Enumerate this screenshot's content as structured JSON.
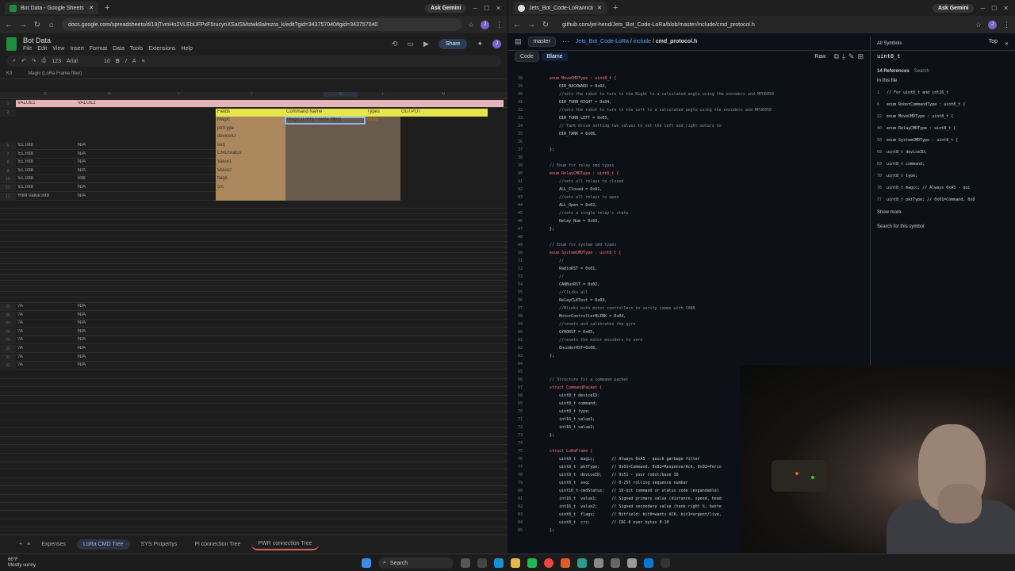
{
  "left_browser": {
    "tab_title": "Bot Data - Google Sheets",
    "url": "docs.google.com/spreadsheets/d/19jTvmHn2VLEbUFPxF5rucynXSaISMstwk8almzra_k/edit?gid=343757040#gid=343757040",
    "ask_gemini": "Ask Gemini"
  },
  "sheet": {
    "title": "Bot Data",
    "menu": [
      "File",
      "Edit",
      "View",
      "Insert",
      "Format",
      "Data",
      "Tools",
      "Extensions",
      "Help"
    ],
    "share_label": "Share",
    "font": "Arial",
    "font_size": "10",
    "zoom": "123",
    "cell_ref": "K3",
    "formula": "Magic (LoRa Frame filter)",
    "col_letters": [
      "G",
      "H",
      "I",
      "J",
      "K",
      "L",
      "M"
    ],
    "row3_headers": [
      "VALUE1",
      "VALUE2"
    ],
    "fields_header": "Fields",
    "command_name_header": "Command Name",
    "types_header": "Types",
    "output_header": "OUTPUT",
    "fields": [
      "Magic",
      "pktType",
      "deviceID",
      "seq",
      "CMDStatus",
      "Value1",
      "Value2",
      "flags",
      "crc"
    ],
    "magic_command": "Magic (LoRa Frame filter)",
    "magic_type": "0xA5",
    "upper_rows": [
      {
        "a": "'EL:int8",
        "b": "N/A"
      },
      {
        "a": "'EL:int8",
        "b": "N/A"
      },
      {
        "a": "'EL:int8",
        "b": "N/A"
      },
      {
        "a": "'EL:int8",
        "b": "N/A"
      },
      {
        "a": "'EL:int8",
        "b": "int8"
      },
      {
        "a": "'EL:int8",
        "b": "N/A"
      },
      {
        "a": "'RIM Value:int8",
        "b": "N/A"
      }
    ],
    "lower_rows": [
      {
        "a": "'/A",
        "b": "N/A"
      },
      {
        "a": "'/A",
        "b": "N/A"
      },
      {
        "a": "'/A",
        "b": "N/A"
      },
      {
        "a": "'/A",
        "b": "N/A"
      },
      {
        "a": "'/A",
        "b": "N/A"
      },
      {
        "a": "'/A",
        "b": "N/A"
      },
      {
        "a": "'/A",
        "b": "N/A"
      },
      {
        "a": "'/A",
        "b": "N/A"
      }
    ],
    "tabs": [
      "Expenses",
      "LoRa CMD Tree",
      "SYS Propertys",
      "Pi connection Tree",
      "PWR connection Tree"
    ]
  },
  "right_browser": {
    "tab_title": "Jets_Bot_Code-LoRa/include/c",
    "url": "github.com/jet-hend/Jets_Bot_Code-LoRa/blob/master/include/cmd_protocol.h",
    "ask_gemini": "Ask Gemini"
  },
  "github": {
    "branch": "master",
    "crumb_repo": "Jets_Bot_Code-LoRa",
    "crumb_dir": "include",
    "crumb_file": "cmd_protocol.h",
    "top_label": "Top",
    "code_tab": "Code",
    "blame_tab": "Blame",
    "raw_label": "Raw",
    "lines": [
      {
        "n": "28",
        "t": "    enum MoveCMDType : uint8_t {"
      },
      {
        "n": "29",
        "t": "        DIR_BACKWARD = 0x03,"
      },
      {
        "n": "30",
        "t": "        //sets the robot to turn to the Right to a calculated angle using the encoders and MPU6050"
      },
      {
        "n": "31",
        "t": "        DIR_TURN_RIGHT = 0x04,"
      },
      {
        "n": "32",
        "t": "        //sets the robot to turn to the Left to a calculated angle using the encoders and MPU6050"
      },
      {
        "n": "33",
        "t": "        DIR_TURN_LEFT = 0x05,"
      },
      {
        "n": "34",
        "t": "        // Tank drive setting two values to set the left and right motors to"
      },
      {
        "n": "35",
        "t": "        DIR_TANK = 0x06,"
      },
      {
        "n": "36",
        "t": ""
      },
      {
        "n": "37",
        "t": "    };"
      },
      {
        "n": "38",
        "t": ""
      },
      {
        "n": "39",
        "t": "    // Enum for relay cmd types"
      },
      {
        "n": "40",
        "t": "    enum RelayCMDType : uint8_t {"
      },
      {
        "n": "41",
        "t": "        //sets all relays to closed"
      },
      {
        "n": "42",
        "t": "        ALL_Closed = 0x01,"
      },
      {
        "n": "43",
        "t": "        //sets all relays to open"
      },
      {
        "n": "44",
        "t": "        ALL_Open = 0x02,"
      },
      {
        "n": "45",
        "t": "        //sets a single relay's state"
      },
      {
        "n": "46",
        "t": "        Relay_Num = 0x03,"
      },
      {
        "n": "47",
        "t": "    };"
      },
      {
        "n": "48",
        "t": ""
      },
      {
        "n": "49",
        "t": "    // Enum for system cmd types"
      },
      {
        "n": "50",
        "t": "    enum SystemCMDType : uint8_t {"
      },
      {
        "n": "51",
        "t": "        //"
      },
      {
        "n": "52",
        "t": "        RadioRST = 0x01,"
      },
      {
        "n": "53",
        "t": "        //"
      },
      {
        "n": "54",
        "t": "        CANBusRST = 0x02,"
      },
      {
        "n": "55",
        "t": "        //Clicks all"
      },
      {
        "n": "56",
        "t": "        RelayCLKTest = 0x03,"
      },
      {
        "n": "57",
        "t": "        //Blinks both motor controllers to verify comms with CAN0"
      },
      {
        "n": "58",
        "t": "        MotorControllerBLINK = 0x04,"
      },
      {
        "n": "59",
        "t": "        //resets and calibrates the gyro"
      },
      {
        "n": "60",
        "t": "        GYRORST = 0x05,"
      },
      {
        "n": "61",
        "t": "        //resets the motor encoders to zero"
      },
      {
        "n": "62",
        "t": "        EncoderRST=0x06,"
      },
      {
        "n": "63",
        "t": "    };"
      },
      {
        "n": "64",
        "t": ""
      },
      {
        "n": "65",
        "t": ""
      },
      {
        "n": "66",
        "t": "    // Structure for a command packet"
      },
      {
        "n": "67",
        "t": "    struct CommandPacket {"
      },
      {
        "n": "68",
        "t": "        uint8_t deviceID;"
      },
      {
        "n": "69",
        "t": "        uint8_t command;"
      },
      {
        "n": "70",
        "t": "        uint8_t type;"
      },
      {
        "n": "71",
        "t": "        int16_t value1;"
      },
      {
        "n": "72",
        "t": "        int16_t value2;"
      },
      {
        "n": "73",
        "t": "    };"
      },
      {
        "n": "74",
        "t": ""
      },
      {
        "n": "75",
        "t": "    struct LoRaFrame {"
      },
      {
        "n": "76",
        "t": "        uint8_t  magic;       // Always 0xA5 - quick garbage filter"
      },
      {
        "n": "77",
        "t": "        uint8_t  pktType;     // 0x01=Command, 0x81=Response/Ack, 0x02=Perio"
      },
      {
        "n": "78",
        "t": "        uint8_t  deviceID;    // 0x51 - your robot/base ID"
      },
      {
        "n": "79",
        "t": "        uint8_t  seq;         // 0-255 rolling sequence number"
      },
      {
        "n": "80",
        "t": "        uint16_t cmdStatus;   // 16-bit command or status code (expandable)"
      },
      {
        "n": "81",
        "t": "        int16_t  value1;      // Signed primary value (distance, speed, head"
      },
      {
        "n": "82",
        "t": "        int16_t  value2;      // Signed secondary value (tank right %, batte"
      },
      {
        "n": "83",
        "t": "        uint8_t  flags;       // Bitfield: bit0=wants ACK, bit1=urgent/live,"
      },
      {
        "n": "84",
        "t": "        uint8_t  crc;         // CRC-8 over bytes 0-10"
      },
      {
        "n": "85",
        "t": "    };"
      }
    ]
  },
  "symbols": {
    "header": "All Symbols",
    "symbol": "uint8_t",
    "refs": "14 References",
    "search": "Search",
    "in_file": "In this file",
    "items": [
      {
        "n": "1",
        "t": "// For uint8_t and int16_t"
      },
      {
        "n": "6",
        "t": "enum RobotCommandType : uint8_t {"
      },
      {
        "n": "22",
        "t": "enum MoveCMDType : uint8_t {"
      },
      {
        "n": "40",
        "t": "enum RelayCMDType : uint8_t {"
      },
      {
        "n": "50",
        "t": "enum SystemCMDType : uint8_t {"
      },
      {
        "n": "68",
        "t": "uint8_t deviceID;"
      },
      {
        "n": "69",
        "t": "uint8_t command;"
      },
      {
        "n": "70",
        "t": "uint8_t type;"
      },
      {
        "n": "76",
        "t": "uint8_t  magic;       // Always 0xA5 - qui"
      },
      {
        "n": "77",
        "t": "uint8_t  pktType;     // 0x01=Command, 0x8"
      }
    ],
    "show_more": "Show more",
    "search_symbol": "Search for this symbol"
  },
  "taskbar": {
    "temp": "66°F",
    "condition": "Mostly sunny",
    "search": "Search"
  },
  "colors": {
    "sheet_bg": "#1e1e1e",
    "header_band": "#e6b3b8",
    "yellow_band": "#e6e64a",
    "orange_fill": "#f5cfa0",
    "github_bg": "#0d1117",
    "link": "#58a6ff"
  }
}
